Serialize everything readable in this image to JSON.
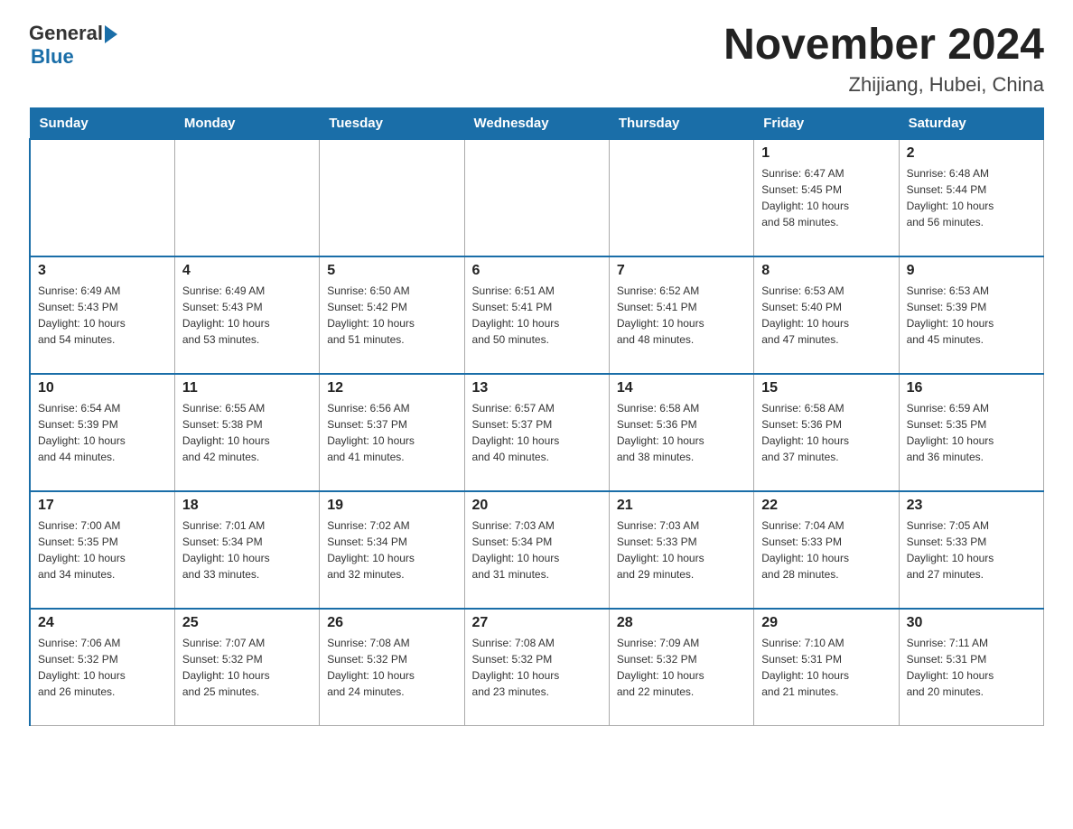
{
  "logo": {
    "general": "General",
    "arrow_color": "#1a6ea8",
    "blue": "Blue"
  },
  "title": "November 2024",
  "subtitle": "Zhijiang, Hubei, China",
  "days_of_week": [
    "Sunday",
    "Monday",
    "Tuesday",
    "Wednesday",
    "Thursday",
    "Friday",
    "Saturday"
  ],
  "weeks": [
    [
      {
        "day": "",
        "info": ""
      },
      {
        "day": "",
        "info": ""
      },
      {
        "day": "",
        "info": ""
      },
      {
        "day": "",
        "info": ""
      },
      {
        "day": "",
        "info": ""
      },
      {
        "day": "1",
        "info": "Sunrise: 6:47 AM\nSunset: 5:45 PM\nDaylight: 10 hours\nand 58 minutes."
      },
      {
        "day": "2",
        "info": "Sunrise: 6:48 AM\nSunset: 5:44 PM\nDaylight: 10 hours\nand 56 minutes."
      }
    ],
    [
      {
        "day": "3",
        "info": "Sunrise: 6:49 AM\nSunset: 5:43 PM\nDaylight: 10 hours\nand 54 minutes."
      },
      {
        "day": "4",
        "info": "Sunrise: 6:49 AM\nSunset: 5:43 PM\nDaylight: 10 hours\nand 53 minutes."
      },
      {
        "day": "5",
        "info": "Sunrise: 6:50 AM\nSunset: 5:42 PM\nDaylight: 10 hours\nand 51 minutes."
      },
      {
        "day": "6",
        "info": "Sunrise: 6:51 AM\nSunset: 5:41 PM\nDaylight: 10 hours\nand 50 minutes."
      },
      {
        "day": "7",
        "info": "Sunrise: 6:52 AM\nSunset: 5:41 PM\nDaylight: 10 hours\nand 48 minutes."
      },
      {
        "day": "8",
        "info": "Sunrise: 6:53 AM\nSunset: 5:40 PM\nDaylight: 10 hours\nand 47 minutes."
      },
      {
        "day": "9",
        "info": "Sunrise: 6:53 AM\nSunset: 5:39 PM\nDaylight: 10 hours\nand 45 minutes."
      }
    ],
    [
      {
        "day": "10",
        "info": "Sunrise: 6:54 AM\nSunset: 5:39 PM\nDaylight: 10 hours\nand 44 minutes."
      },
      {
        "day": "11",
        "info": "Sunrise: 6:55 AM\nSunset: 5:38 PM\nDaylight: 10 hours\nand 42 minutes."
      },
      {
        "day": "12",
        "info": "Sunrise: 6:56 AM\nSunset: 5:37 PM\nDaylight: 10 hours\nand 41 minutes."
      },
      {
        "day": "13",
        "info": "Sunrise: 6:57 AM\nSunset: 5:37 PM\nDaylight: 10 hours\nand 40 minutes."
      },
      {
        "day": "14",
        "info": "Sunrise: 6:58 AM\nSunset: 5:36 PM\nDaylight: 10 hours\nand 38 minutes."
      },
      {
        "day": "15",
        "info": "Sunrise: 6:58 AM\nSunset: 5:36 PM\nDaylight: 10 hours\nand 37 minutes."
      },
      {
        "day": "16",
        "info": "Sunrise: 6:59 AM\nSunset: 5:35 PM\nDaylight: 10 hours\nand 36 minutes."
      }
    ],
    [
      {
        "day": "17",
        "info": "Sunrise: 7:00 AM\nSunset: 5:35 PM\nDaylight: 10 hours\nand 34 minutes."
      },
      {
        "day": "18",
        "info": "Sunrise: 7:01 AM\nSunset: 5:34 PM\nDaylight: 10 hours\nand 33 minutes."
      },
      {
        "day": "19",
        "info": "Sunrise: 7:02 AM\nSunset: 5:34 PM\nDaylight: 10 hours\nand 32 minutes."
      },
      {
        "day": "20",
        "info": "Sunrise: 7:03 AM\nSunset: 5:34 PM\nDaylight: 10 hours\nand 31 minutes."
      },
      {
        "day": "21",
        "info": "Sunrise: 7:03 AM\nSunset: 5:33 PM\nDaylight: 10 hours\nand 29 minutes."
      },
      {
        "day": "22",
        "info": "Sunrise: 7:04 AM\nSunset: 5:33 PM\nDaylight: 10 hours\nand 28 minutes."
      },
      {
        "day": "23",
        "info": "Sunrise: 7:05 AM\nSunset: 5:33 PM\nDaylight: 10 hours\nand 27 minutes."
      }
    ],
    [
      {
        "day": "24",
        "info": "Sunrise: 7:06 AM\nSunset: 5:32 PM\nDaylight: 10 hours\nand 26 minutes."
      },
      {
        "day": "25",
        "info": "Sunrise: 7:07 AM\nSunset: 5:32 PM\nDaylight: 10 hours\nand 25 minutes."
      },
      {
        "day": "26",
        "info": "Sunrise: 7:08 AM\nSunset: 5:32 PM\nDaylight: 10 hours\nand 24 minutes."
      },
      {
        "day": "27",
        "info": "Sunrise: 7:08 AM\nSunset: 5:32 PM\nDaylight: 10 hours\nand 23 minutes."
      },
      {
        "day": "28",
        "info": "Sunrise: 7:09 AM\nSunset: 5:32 PM\nDaylight: 10 hours\nand 22 minutes."
      },
      {
        "day": "29",
        "info": "Sunrise: 7:10 AM\nSunset: 5:31 PM\nDaylight: 10 hours\nand 21 minutes."
      },
      {
        "day": "30",
        "info": "Sunrise: 7:11 AM\nSunset: 5:31 PM\nDaylight: 10 hours\nand 20 minutes."
      }
    ]
  ]
}
